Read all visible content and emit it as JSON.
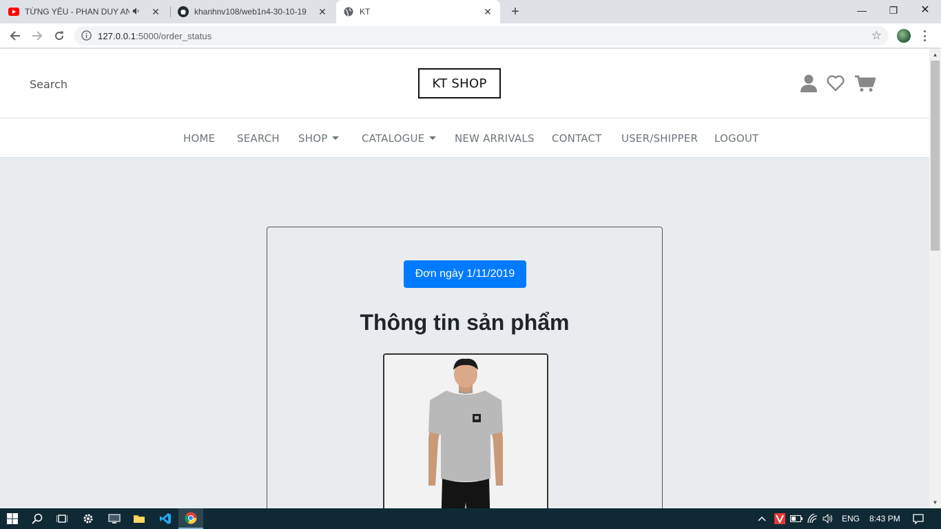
{
  "browser": {
    "tabs": [
      {
        "title": "TỪNG YÊU - PHAN DUY ANH",
        "favicon": "youtube-icon",
        "audio": true
      },
      {
        "title": "khanhnv108/web1n4-30-10-19",
        "favicon": "github-icon"
      },
      {
        "title": "KT",
        "favicon": "globe-icon"
      }
    ],
    "active_tab": 2,
    "url_host": "127.0.0.1",
    "url_path": ":5000/order_status"
  },
  "site": {
    "search_label": "Search",
    "logo": "KT SHOP",
    "nav": [
      {
        "label": "HOME",
        "dropdown": false
      },
      {
        "label": "SEARCH",
        "dropdown": false
      },
      {
        "label": "SHOP",
        "dropdown": true
      },
      {
        "label": "CATALOGUE",
        "dropdown": true
      },
      {
        "label": "NEW ARRIVALS",
        "dropdown": false
      },
      {
        "label": "CONTACT",
        "dropdown": false
      },
      {
        "label": "USER/SHIPPER",
        "dropdown": false
      },
      {
        "label": "LOGOUT",
        "dropdown": false
      }
    ],
    "header_icons": [
      "user-icon",
      "heart-icon",
      "cart-icon"
    ]
  },
  "order": {
    "date_button": "Đơn ngày 1/11/2019",
    "section_title": "Thông tin sản phẩm",
    "product_image": "grey-tshirt-model"
  },
  "taskbar": {
    "language": "ENG",
    "time": "8:43 PM"
  },
  "colors": {
    "primary": "#007bff",
    "page_bg": "#e9ecef",
    "nav_text": "#6c757d",
    "icon_grey": "#888888"
  }
}
